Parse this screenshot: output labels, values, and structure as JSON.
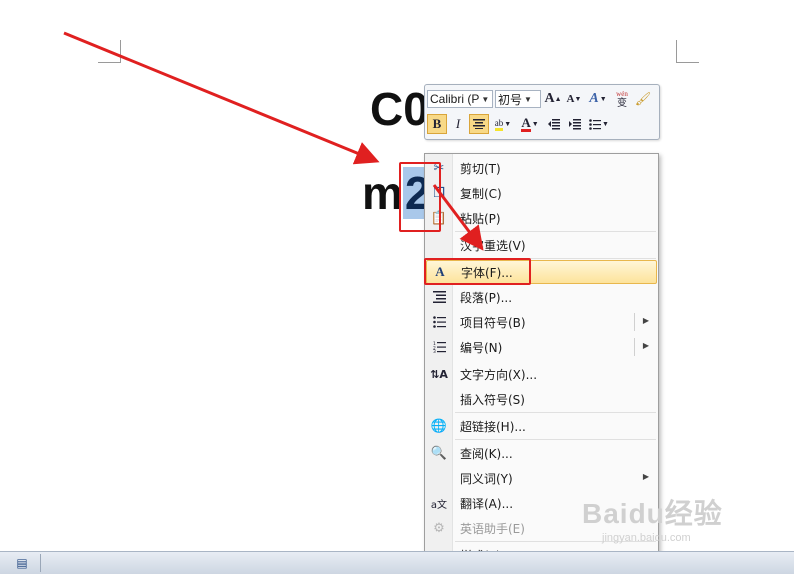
{
  "document": {
    "line1": "C0",
    "line2_prefix": "m",
    "line2_selected": "2"
  },
  "mini_toolbar": {
    "font_name": "Calibri (P",
    "font_size": "初号",
    "grow_font": "A",
    "shrink_font": "A",
    "font_color_style": "A",
    "phonetic": "wén",
    "phonetic_char": "变",
    "bold": "B",
    "italic": "I",
    "highlight": "ab",
    "font_color": "A"
  },
  "context_menu": {
    "items": [
      {
        "label": "剪切(T)",
        "icon": "scissors-icon",
        "enabled": true
      },
      {
        "label": "复制(C)",
        "icon": "copy-icon",
        "enabled": true
      },
      {
        "label": "粘贴(P)",
        "icon": "paste-icon",
        "enabled": true
      },
      {
        "label": "汉字重选(V)",
        "icon": "",
        "enabled": true
      },
      {
        "label": "字体(F)...",
        "icon": "font-icon",
        "enabled": true,
        "highlighted": true
      },
      {
        "label": "段落(P)...",
        "icon": "paragraph-icon",
        "enabled": true
      },
      {
        "label": "项目符号(B)",
        "icon": "bullets-icon",
        "enabled": true,
        "submenu": true
      },
      {
        "label": "编号(N)",
        "icon": "numbering-icon",
        "enabled": true,
        "submenu": true
      },
      {
        "label": "文字方向(X)...",
        "icon": "text-direction-icon",
        "enabled": true
      },
      {
        "label": "插入符号(S)",
        "icon": "",
        "enabled": true
      },
      {
        "label": "超链接(H)...",
        "icon": "hyperlink-icon",
        "enabled": true
      },
      {
        "label": "查阅(K)...",
        "icon": "research-icon",
        "enabled": true
      },
      {
        "label": "同义词(Y)",
        "icon": "",
        "enabled": true,
        "submenu": true
      },
      {
        "label": "翻译(A)...",
        "icon": "translate-icon",
        "enabled": true
      },
      {
        "label": "英语助手(E)",
        "icon": "english-assistant-icon",
        "enabled": false
      },
      {
        "label": "样式(T)",
        "icon": "",
        "enabled": true,
        "submenu": true
      }
    ]
  },
  "watermark": {
    "brand": "Baidu经验",
    "url": "jingyan.baidu.com"
  },
  "annotation_color": "#e02020",
  "highlight_color": "#fde39b"
}
